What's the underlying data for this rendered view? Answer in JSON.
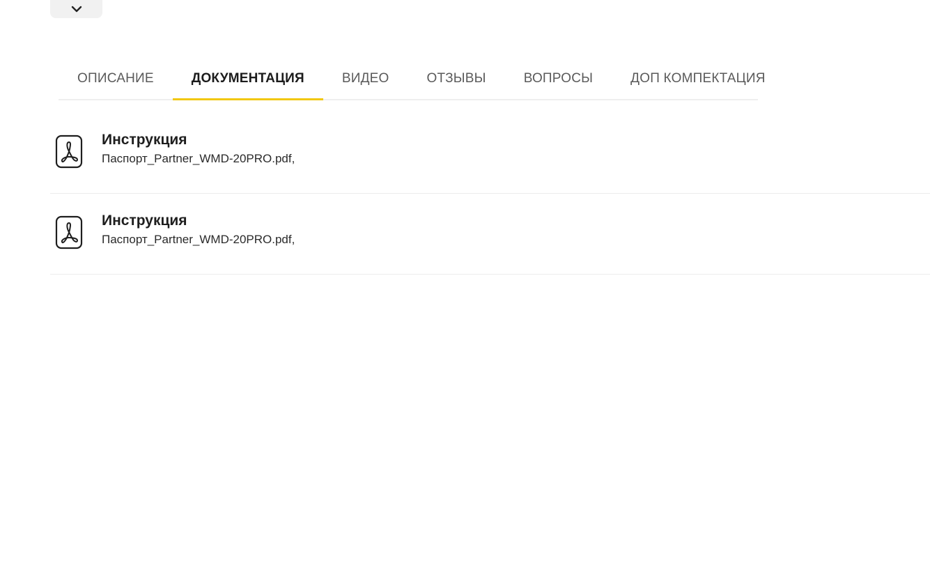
{
  "collapse_button": {
    "icon": "chevron-down-icon"
  },
  "tabs": [
    {
      "label": "ОПИСАНИЕ",
      "active": false
    },
    {
      "label": "ДОКУМЕНТАЦИЯ",
      "active": true
    },
    {
      "label": "ВИДЕО",
      "active": false
    },
    {
      "label": "ОТЗЫВЫ",
      "active": false
    },
    {
      "label": "ВОПРОСЫ",
      "active": false
    },
    {
      "label": "ДОП КОМПЕКТАЦИЯ",
      "active": false
    }
  ],
  "colors": {
    "accent": "#f2c811",
    "active_tab_text": "#1c1c1c",
    "inactive_tab_text": "#5a5a5a",
    "divider": "#ececec"
  },
  "documents": [
    {
      "icon": "pdf-icon",
      "title": "Инструкция",
      "filename": "Паспорт_Partner_WMD-20PRO.pdf,"
    },
    {
      "icon": "pdf-icon",
      "title": "Инструкция",
      "filename": "Паспорт_Partner_WMD-20PRO.pdf,"
    }
  ]
}
